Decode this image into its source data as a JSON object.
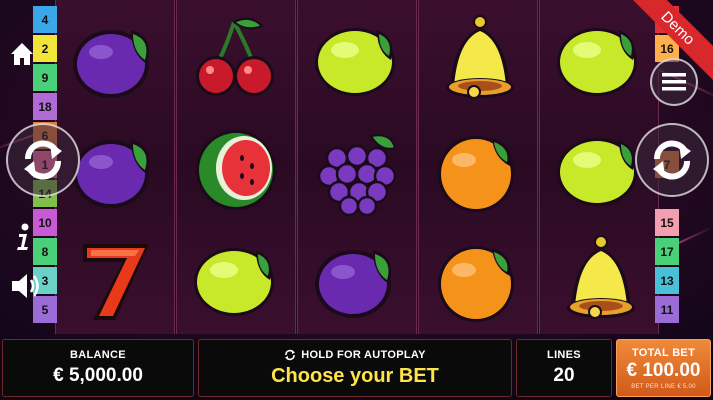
{
  "demo_label": "Demo",
  "left_lines": [
    "4",
    "2",
    "9",
    "18",
    "6",
    "1",
    "14",
    "10",
    "8",
    "3",
    "5"
  ],
  "right_lines": [
    "12",
    "16",
    "",
    "",
    "",
    "7",
    "",
    "15",
    "17",
    "13",
    "11"
  ],
  "left_line_colors": [
    "#3aa7e8",
    "#f2e53a",
    "#4bd07a",
    "#b06bd6",
    "#e37c3a",
    "#f26aa0",
    "#7fbf4a",
    "#c85ad6",
    "#4bd07a",
    "#6ad0c8",
    "#9b6bd6"
  ],
  "right_line_colors": [
    "#e0303a",
    "#ffb04a",
    "#3aa7e8",
    "#f26aa0",
    "#7fbf4a",
    "#e37c3a",
    "#b06bd6",
    "#f2a0b0",
    "#4bd07a",
    "#4ac0d8",
    "#9b6bd6"
  ],
  "reels": [
    [
      "plum",
      "plum",
      "seven"
    ],
    [
      "cherry",
      "watermelon",
      "lemon"
    ],
    [
      "lemon",
      "grapes",
      "plum"
    ],
    [
      "bell",
      "orange",
      "orange"
    ],
    [
      "lemon",
      "lemon",
      "bell"
    ]
  ],
  "footer": {
    "balance_label": "BALANCE",
    "balance_value": "€ 5,000.00",
    "autoplay_label": "HOLD FOR AUTOPLAY",
    "choose_label": "Choose your BET",
    "lines_label": "LINES",
    "lines_value": "20",
    "total_bet_label": "TOTAL BET",
    "total_bet_value": "€ 100.00",
    "bet_per_line": "BET PER LINE € 5.00"
  },
  "icons": {
    "home": "home-icon",
    "info": "info-icon",
    "sound": "speaker-icon",
    "spin": "spin-arrows-icon",
    "menu": "menu-icon",
    "autoplay": "autoplay-arrows-icon"
  }
}
